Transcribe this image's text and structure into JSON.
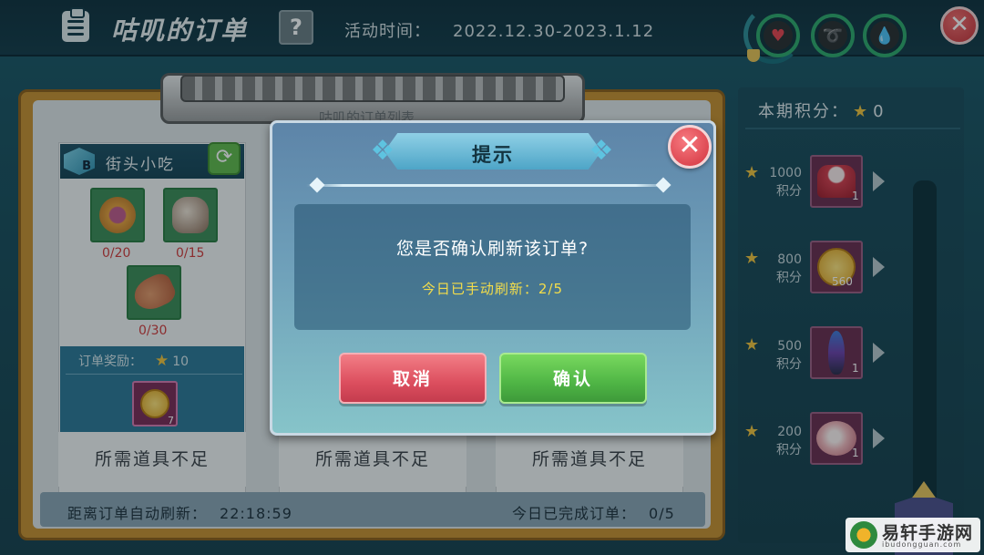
{
  "header": {
    "title": "咕叽的订单",
    "help_label": "?",
    "event_label": "活动时间：",
    "event_range": "2022.12.30-2023.1.12",
    "close_label": "✕"
  },
  "board": {
    "list_title": "咕叽的订单列表",
    "card1": {
      "badge": "B",
      "title": "街头小吃",
      "items": [
        {
          "icon": "pie-icon",
          "qty": "0/20"
        },
        {
          "icon": "mushroom-bun-icon",
          "qty": "0/15"
        },
        {
          "icon": "drumstick-icon",
          "qty": "0/30"
        }
      ],
      "reward_label": "订单奖励：",
      "reward_points": "10",
      "reward_item_count": "7"
    },
    "insufficient_label": "所需道具不足",
    "footer": {
      "auto_refresh_label": "距离订单自动刷新：",
      "auto_refresh_time": "22:18:59",
      "completed_label": "今日已完成订单：",
      "completed_value": "0/5"
    }
  },
  "points_panel": {
    "title": "本期积分：",
    "current_points": "0",
    "tiers": [
      {
        "points": "1000",
        "unit": "积分",
        "icon": "cake-icon",
        "count": "1"
      },
      {
        "points": "800",
        "unit": "积分",
        "icon": "gold-coin-icon",
        "count": "560"
      },
      {
        "points": "500",
        "unit": "积分",
        "icon": "feather-icon",
        "count": "1"
      },
      {
        "points": "200",
        "unit": "积分",
        "icon": "flower-icon",
        "count": "1"
      }
    ]
  },
  "dialog": {
    "title": "提示",
    "close_label": "✕",
    "question": "您是否确认刷新该订单?",
    "note": "今日已手动刷新：2/5",
    "cancel_label": "取消",
    "confirm_label": "确认"
  },
  "watermark": {
    "text": "易轩手游网",
    "sub": "ibudongguan.com"
  },
  "colors": {
    "cancel": "#dc4e5e",
    "confirm": "#4fb545",
    "note": "#f4dd4a",
    "qty_short": "#d23a3a"
  }
}
